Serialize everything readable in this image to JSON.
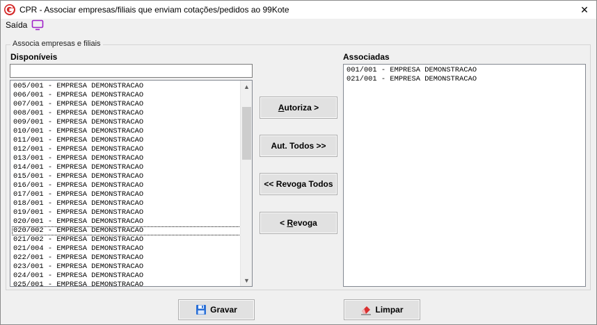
{
  "window": {
    "title": "CPR - Associar empresas/filiais que enviam cotações/pedidos ao 99Kote",
    "close_glyph": "✕"
  },
  "menu": {
    "saida_label": "Saída",
    "monitor_icon": "monitor-icon"
  },
  "group": {
    "legend": "Associa empresas e filiais"
  },
  "disponiveis": {
    "label": "Disponíveis",
    "search_value": "",
    "items": [
      "005/001 - EMPRESA DEMONSTRACAO",
      "006/001 - EMPRESA DEMONSTRACAO",
      "007/001 - EMPRESA DEMONSTRACAO",
      "008/001 - EMPRESA DEMONSTRACAO",
      "009/001 - EMPRESA DEMONSTRACAO",
      "010/001 - EMPRESA DEMONSTRACAO",
      "011/001 - EMPRESA DEMONSTRACAO",
      "012/001 - EMPRESA DEMONSTRACAO",
      "013/001 - EMPRESA DEMONSTRACAO",
      "014/001 - EMPRESA DEMONSTRACAO",
      "015/001 - EMPRESA DEMONSTRACAO",
      "016/001 - EMPRESA DEMONSTRACAO",
      "017/001 - EMPRESA DEMONSTRACAO",
      "018/001 - EMPRESA DEMONSTRACAO",
      "019/001 - EMPRESA DEMONSTRACAO",
      "020/001 - EMPRESA DEMONSTRACAO",
      "020/002 - EMPRESA DEMONSTRACAO",
      "021/002 - EMPRESA DEMONSTRACAO",
      "021/004 - EMPRESA DEMONSTRACAO",
      "022/001 - EMPRESA DEMONSTRACAO",
      "023/001 - EMPRESA DEMONSTRACAO",
      "024/001 - EMPRESA DEMONSTRACAO",
      "025/001 - EMPRESA DEMONSTRACAO"
    ],
    "focused_item": "020/002 - EMPRESA DEMONSTRACAO"
  },
  "associadas": {
    "label": "Associadas",
    "items": [
      "001/001 - EMPRESA DEMONSTRACAO",
      "021/001 - EMPRESA DEMONSTRACAO"
    ]
  },
  "buttons": {
    "autoriza": {
      "mnemonic": "A",
      "rest": "utoriza >"
    },
    "aut_todos": {
      "label": "Aut. Todos >>"
    },
    "revoga_todos": {
      "label": "<< Revoga Todos"
    },
    "revoga": {
      "prefix": "< ",
      "mnemonic": "R",
      "rest": "evoga"
    },
    "gravar": {
      "label": "Gravar",
      "icon": "floppy-disk-icon"
    },
    "limpar": {
      "label": "Limpar",
      "icon": "eraser-icon"
    }
  },
  "colors": {
    "app_logo_red": "#d42a2a",
    "monitor_purple": "#a020c8",
    "floppy_blue": "#2a6fd6",
    "eraser_red": "#d93030"
  }
}
